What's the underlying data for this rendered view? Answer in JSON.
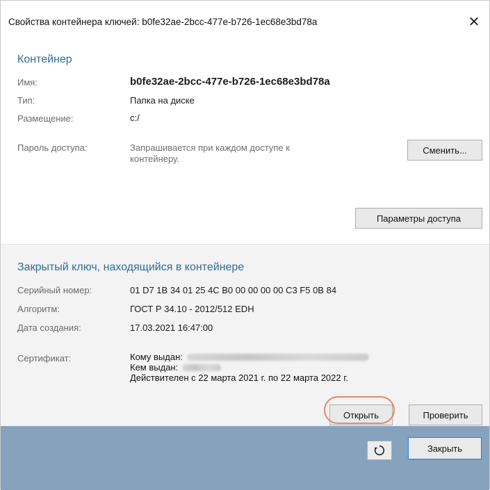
{
  "window": {
    "title": "Свойства контейнера ключей: b0fe32ae-2bcc-477e-b726-1ec68e3bd78a",
    "close_glyph": "✕"
  },
  "container": {
    "heading": "Контейнер",
    "name_label": "Имя:",
    "name_value": "b0fe32ae-2bcc-477e-b726-1ec68e3bd78a",
    "type_label": "Тип:",
    "type_value": "Папка на диске",
    "location_label": "Размещение:",
    "location_value": "c:/",
    "password_label": "Пароль доступа:",
    "password_value": "Запрашивается при каждом доступе к контейнеру.",
    "change_button": "Сменить...",
    "access_params_button": "Параметры доступа"
  },
  "private_key": {
    "heading": "Закрытый ключ, находящийся в контейнере",
    "serial_label": "Серийный номер:",
    "serial_value": "01 D7 1B 34 01 25 4C B0 00 00 00 00 C3 F5 0B 84",
    "algorithm_label": "Алгоритм:",
    "algorithm_value": "ГОСТ Р 34.10 - 2012/512 EDH",
    "created_label": "Дата создания:",
    "created_value": "17.03.2021 16:47:00",
    "certificate_label": "Сертификат:",
    "issued_to_label": "Кому выдан:",
    "issued_by_label": "Кем выдан:",
    "validity": "Действителен с 22 марта 2021 г. по 22 марта 2022 г.",
    "open_button": "Открыть",
    "verify_button": "Проверить"
  },
  "footer": {
    "refresh_icon": "refresh-icon",
    "close_button": "Закрыть"
  },
  "colors": {
    "heading": "#2f6b9a",
    "footer_bg": "#86a2bd",
    "highlight": "#e2876f",
    "primary_border": "#2b7fd4"
  }
}
